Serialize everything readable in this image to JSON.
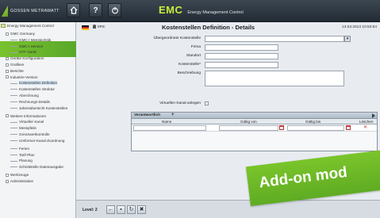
{
  "header": {
    "logo_text": "GOSSEN METRAWATT",
    "title": "EMC",
    "subtitle": "Energy Management Control"
  },
  "toolbar_icons": [
    "home-icon",
    "help-icon",
    "power-icon"
  ],
  "sidebar": {
    "items": [
      {
        "label": "Energy Management Control",
        "level": 0
      },
      {
        "label": "GMC Germany",
        "level": 1
      },
      {
        "label": "GMC-I Messtechnik",
        "level": 2
      },
      {
        "label": "GMC-I Service",
        "level": 2
      },
      {
        "label": "HTF Gerät",
        "level": 2
      },
      {
        "label": "Geräte Konfiguration",
        "level": 1
      },
      {
        "label": "Grafiken",
        "level": 1
      },
      {
        "label": "Berichte",
        "level": 1
      },
      {
        "label": "Industrie-Version",
        "level": 1
      },
      {
        "label": "Kostenstellen Definition",
        "level": 2
      },
      {
        "label": "Kostenstellen Struktur",
        "level": 2
      },
      {
        "label": "Abrechnung",
        "level": 2
      },
      {
        "label": "Rechnungs-Details",
        "level": 2
      },
      {
        "label": "Jahresübersicht Kostenstellen",
        "level": 2
      },
      {
        "label": "Weitere Informationen",
        "level": 1
      },
      {
        "label": "Virtueller Kanal",
        "level": 2
      },
      {
        "label": "Messpfeile",
        "level": 2
      },
      {
        "label": "Grenzwertkontrolle",
        "level": 2
      },
      {
        "label": "Umformer-Kanal-Zuordnung",
        "level": 2
      },
      {
        "label": "Ferien",
        "level": 2
      },
      {
        "label": "Tarif-Plan",
        "level": 2
      },
      {
        "label": "Planung",
        "level": 2
      },
      {
        "label": "Schnittstelle Datenausgabe",
        "level": 2
      },
      {
        "label": "Werkzeuge",
        "level": 1
      },
      {
        "label": "Administration",
        "level": 1
      }
    ]
  },
  "main": {
    "user": "emc",
    "page_title": "Kostenstellen Definition - Details",
    "datetime": "13.03.2013 10:53:54",
    "fields": {
      "parent_label": "Übergeordnete Kostenstelle",
      "company_label": "Firma",
      "location_label": "Standort",
      "cost_center_label": "Kostenstelle*",
      "description_label": "Beschreibung",
      "virtual_channel_label": "Virtuellen Kanal anlegen"
    },
    "table": {
      "title": "Verantwortlich",
      "columns": [
        "Name",
        "Gültig von",
        "Gültig bis",
        "Löschen"
      ]
    }
  },
  "bottom": {
    "level_label": "Level: 2"
  },
  "banner": {
    "text": "Add-on mod"
  },
  "colors": {
    "accent_green": "#79c22d",
    "emc_title": "#c9ec3a",
    "topbar": "#2b343d"
  }
}
